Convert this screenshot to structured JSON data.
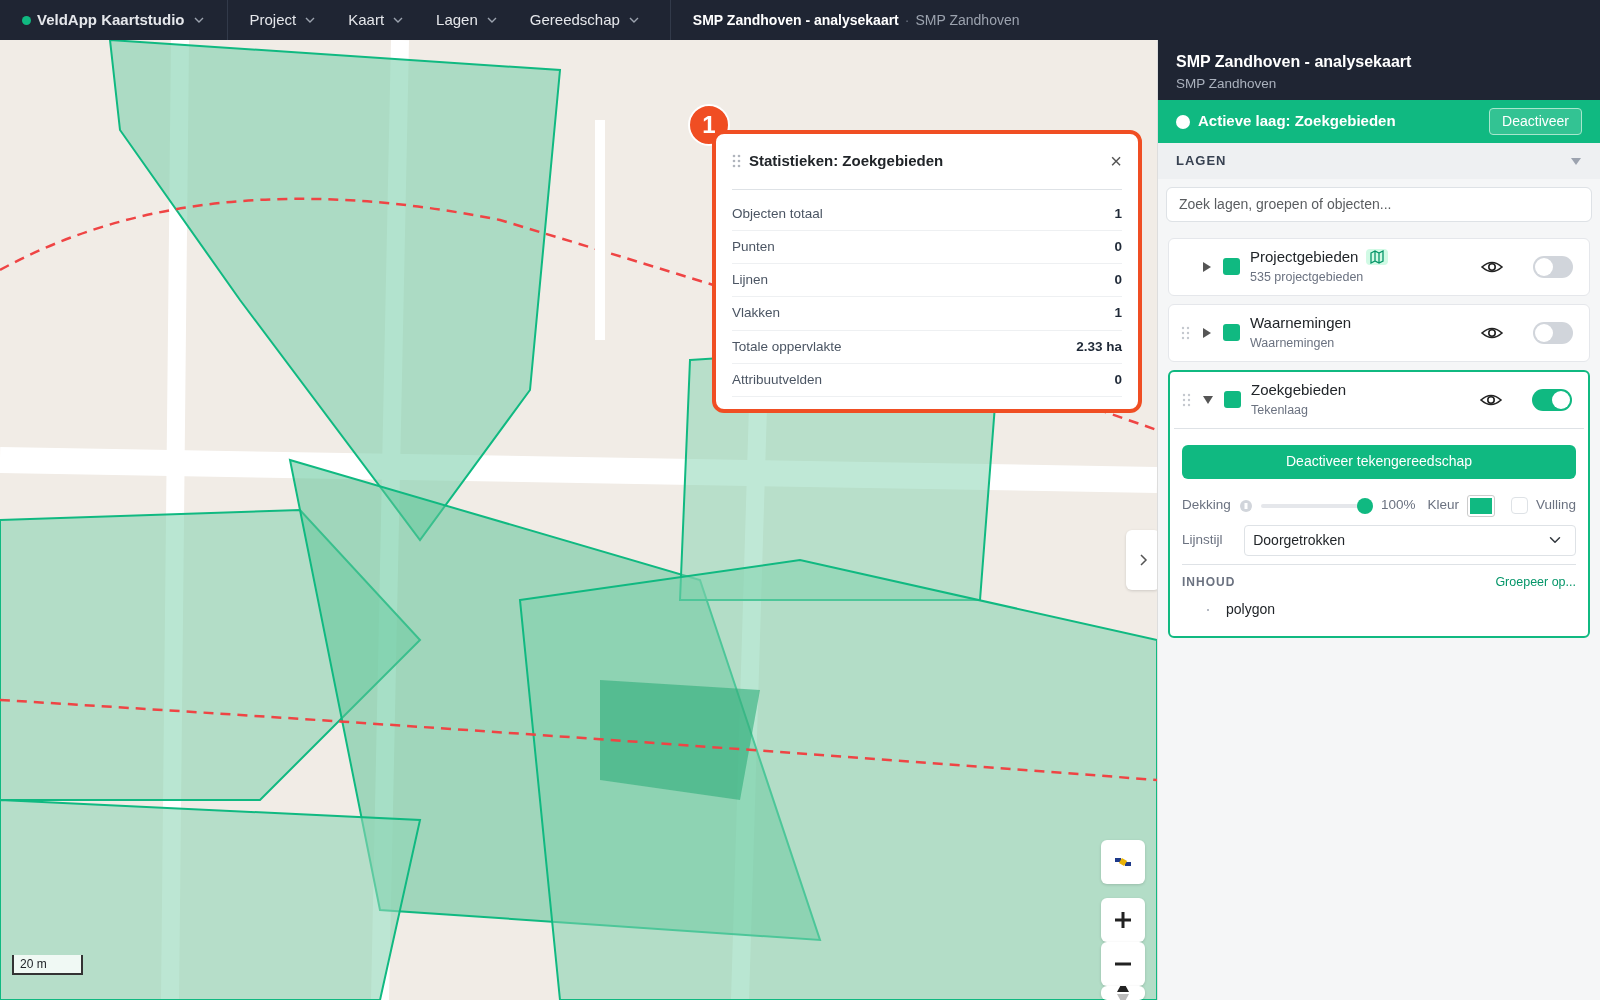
{
  "topbar": {
    "app": {
      "name": "VeldApp Kaartstudio"
    },
    "menus": [
      {
        "label": "Project"
      },
      {
        "label": "Kaart"
      },
      {
        "label": "Lagen"
      },
      {
        "label": "Gereedschap"
      }
    ],
    "breadcrumb": {
      "title": "SMP Zandhoven - analysekaart",
      "separator": "·",
      "subtitle": "SMP Zandhoven"
    }
  },
  "map": {
    "kind": "picture",
    "scale": "20 m"
  },
  "stats_popup": {
    "badge": "1",
    "title": "Statistieken: Zoekgebieden",
    "close": "×",
    "rows": [
      {
        "label": "Objecten totaal",
        "value": "1"
      },
      {
        "label": "Punten",
        "value": "0"
      },
      {
        "label": "Lijnen",
        "value": "0"
      },
      {
        "label": "Vlakken",
        "value": "1"
      },
      {
        "label": "Totale oppervlakte",
        "value": "2.33 ha"
      },
      {
        "label": "Attribuutvelden",
        "value": "0"
      }
    ]
  },
  "panel": {
    "title": "SMP Zandhoven - analysekaart",
    "subtitle": "SMP Zandhoven",
    "active_layer": {
      "label": "Actieve laag: Zoekgebieden",
      "button": "Deactiveer"
    },
    "section": "LAGEN",
    "search": {
      "placeholder": "Zoek lagen, groepen of objecten..."
    },
    "layers": [
      {
        "name": "Projectgebieden",
        "sub": "535 projectgebieden",
        "color": "#10b981",
        "draggable": false,
        "map_badge": true,
        "expanded": false,
        "on": false
      },
      {
        "name": "Waarnemingen",
        "sub": "Waarnemingen",
        "color": "#10b981",
        "draggable": true,
        "map_badge": false,
        "expanded": false,
        "on": false
      },
      {
        "name": "Zoekgebieden",
        "sub": "Tekenlaag",
        "color": "#10b981",
        "draggable": true,
        "map_badge": false,
        "expanded": true,
        "on": true,
        "details": {
          "button": "Deactiveer tekengereedschap",
          "opacity": {
            "label": "Dekking",
            "level": 1,
            "reading": "100%"
          },
          "color_label": "Kleur",
          "fill": {
            "label": "Vulling",
            "checked": false
          },
          "line_style": {
            "label": "Lijnstijl",
            "value": "Doorgetrokken"
          },
          "content": {
            "title": "INHOUD",
            "action": "Groepeer op...",
            "items": [
              {
                "label": "polygon"
              }
            ]
          }
        }
      }
    ]
  }
}
